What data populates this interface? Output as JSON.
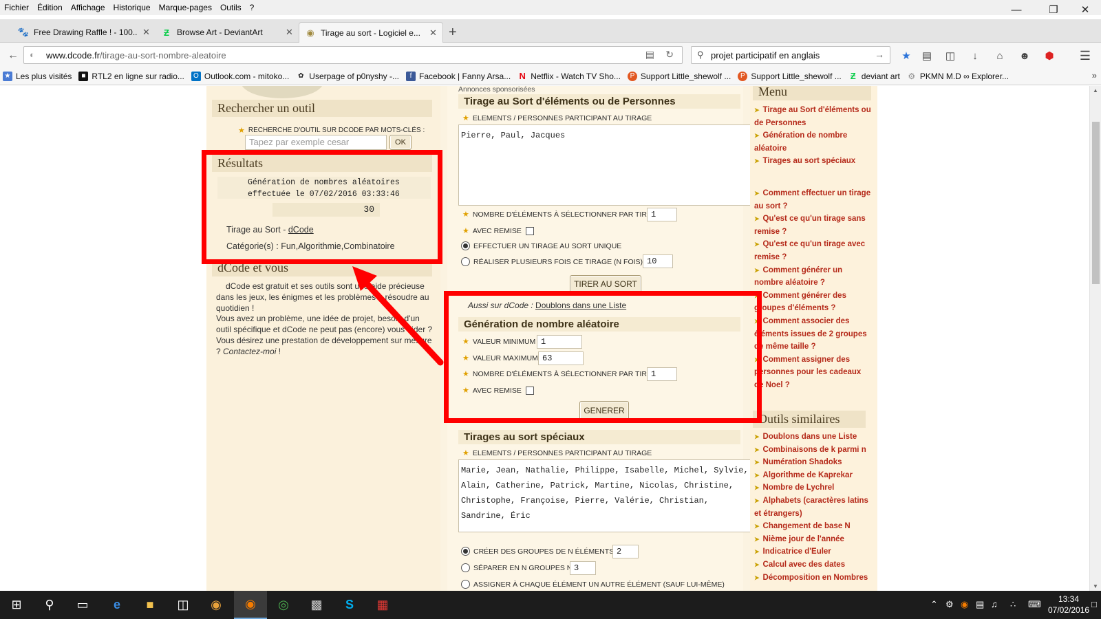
{
  "menubar": {
    "items": [
      "Fichier",
      "Édition",
      "Affichage",
      "Historique",
      "Marque-pages",
      "Outils",
      "?"
    ]
  },
  "tabs": [
    {
      "title": "Free Drawing Raffle ! - 100...",
      "icon": "paw-icon"
    },
    {
      "title": "Browse Art - DeviantArt",
      "icon": "deviantart-icon"
    },
    {
      "title": "Tirage au sort - Logiciel e...",
      "icon": "dcode-icon"
    }
  ],
  "navbar": {
    "url_domain": "www.dcode.fr",
    "url_path": "/tirage-au-sort-nombre-aleatoire",
    "search_value": "projet participatif en anglais"
  },
  "bookmarks": [
    {
      "label": "Les plus visités",
      "color": "#4a7bd4"
    },
    {
      "label": "RTL2 en ligne sur radio...",
      "color": "#111111"
    },
    {
      "label": "Outlook.com - mitoko...",
      "color": "#0072c6"
    },
    {
      "label": "Userpage of p0nyshy -...",
      "color": "#222222"
    },
    {
      "label": "Facebook | Fanny Arsa...",
      "color": "#3b5998"
    },
    {
      "label": "Netflix - Watch TV Sho...",
      "color": "#e50914"
    },
    {
      "label": "Support Little_shewolf ...",
      "color": "#e25822"
    },
    {
      "label": "Support Little_shewolf ...",
      "color": "#e25822"
    },
    {
      "label": "deviant art",
      "color": "#05cc47"
    },
    {
      "label": "PKMN M.D ∞ Explorer...",
      "color": "#888888"
    }
  ],
  "left": {
    "search_title": "Rechercher un outil",
    "search_label": "RECHERCHE D'OUTIL SUR DCODE PAR MOTS-CLÉS :",
    "search_placeholder": "Tapez par exemple cesar",
    "ok_label": "OK",
    "results_title": "Résultats",
    "results_line1": "Génération de nombres aléatoires",
    "results_line2": "effectuée le 07/02/2016 03:33:46",
    "results_value": "30",
    "results_link_prefix": "Tirage au Sort - ",
    "results_link": "dCode",
    "results_categories": "Catégorie(s) : Fun,Algorithmie,Combinatoire",
    "dcode_title": "dCode et vous",
    "dcode_text1": "dCode est gratuit et ses outils sont une aide précieuse dans les jeux, les énigmes et les problèmes à résoudre au quotidien !",
    "dcode_text2": "Vous avez un problème, une idée de projet, besoin d'un outil spécifique et dCode ne peut pas (encore) vous aider ? Vous désirez une prestation de développement sur mesure ? ",
    "dcode_contact": "Contactez-moi",
    "dcode_end": " !"
  },
  "main": {
    "sponsored": "Annonces sponsorisées",
    "draw_title": "Tirage au Sort d'éléments ou de Personnes",
    "draw_elements_label": "ELEMENTS / PERSONNES PARTICIPANT AU TIRAGE",
    "draw_elements_value": "Pierre, Paul, Jacques",
    "draw_count_label": "NOMBRE D'ÉLÉMENTS À SÉLECTIONNER PAR TIRAGE",
    "draw_count_value": "1",
    "draw_replace_label": "AVEC REMISE",
    "draw_single_label": "EFFECTUER UN TIRAGE AU SORT UNIQUE",
    "draw_multi_label": "RÉALISER PLUSIEURS FOIS CE TIRAGE (N FOIS) N=",
    "draw_multi_value": "10",
    "draw_button": "TIRER AU SORT",
    "also_prefix": "Aussi sur dCode : ",
    "also_link": "Doublons dans une Liste",
    "rng_title": "Génération de nombre aléatoire",
    "rng_min_label": "VALEUR MINIMUM",
    "rng_min_value": "1",
    "rng_max_label": "VALEUR MAXIMUM",
    "rng_max_value": "63",
    "rng_count_label": "NOMBRE D'ÉLÉMENTS À SÉLECTIONNER PAR TIRAGE",
    "rng_count_value": "1",
    "rng_replace_label": "AVEC REMISE",
    "rng_button": "GENERER",
    "special_title": "Tirages au sort spéciaux",
    "special_elements_label": "ELEMENTS / PERSONNES PARTICIPANT AU TIRAGE",
    "special_elements_value": "Marie, Jean, Nathalie, Philippe, Isabelle, Michel, Sylvie,\nAlain, Catherine, Patrick, Martine, Nicolas, Christine,\nChristophe, Françoise, Pierre, Valérie, Christian,\nSandrine, Éric",
    "special_groups_label": "CRÉER DES GROUPES DE N ÉLÉMENTS N=",
    "special_groups_value": "2",
    "special_split_label": "SÉPARER EN N GROUPES N=",
    "special_split_value": "3",
    "special_assign_label": "ASSIGNER À CHAQUE ÉLÉMENT UN AUTRE ÉLÉMENT (SAUF LUI-MÊME)"
  },
  "right": {
    "menu_title": "Menu",
    "menu_links": [
      "Tirage au Sort d'éléments ou de Personnes",
      "Génération de nombre aléatoire",
      "Tirages au sort spéciaux"
    ],
    "faq_links": [
      "Comment effectuer un tirage au sort ?",
      "Qu'est ce qu'un tirage sans remise ?",
      "Qu'est ce qu'un tirage avec remise ?",
      "Comment générer un nombre aléatoire ?",
      "Comment générer des groupes d'éléments ?",
      "Comment associer des éléments issues de 2 groupes de même taille ?",
      "Comment assigner des personnes pour les cadeaux de Noel ?"
    ],
    "similar_title": "Outils similaires",
    "similar_links": [
      "Doublons dans une Liste",
      "Combinaisons de k parmi n",
      "Numération Shadoks",
      "Algorithme de Kaprekar",
      "Nombre de Lychrel",
      "Alphabets (caractères latins et étrangers)",
      "Changement de base N",
      "Nième jour de l'année",
      "Indicatrice d'Euler",
      "Calcul avec des dates",
      "Décomposition en Nombres"
    ]
  },
  "clock": {
    "time": "13:34",
    "date": "07/02/2016"
  },
  "colors": {
    "annotation_red": "#ff0000",
    "link_red": "#b52a1a"
  }
}
